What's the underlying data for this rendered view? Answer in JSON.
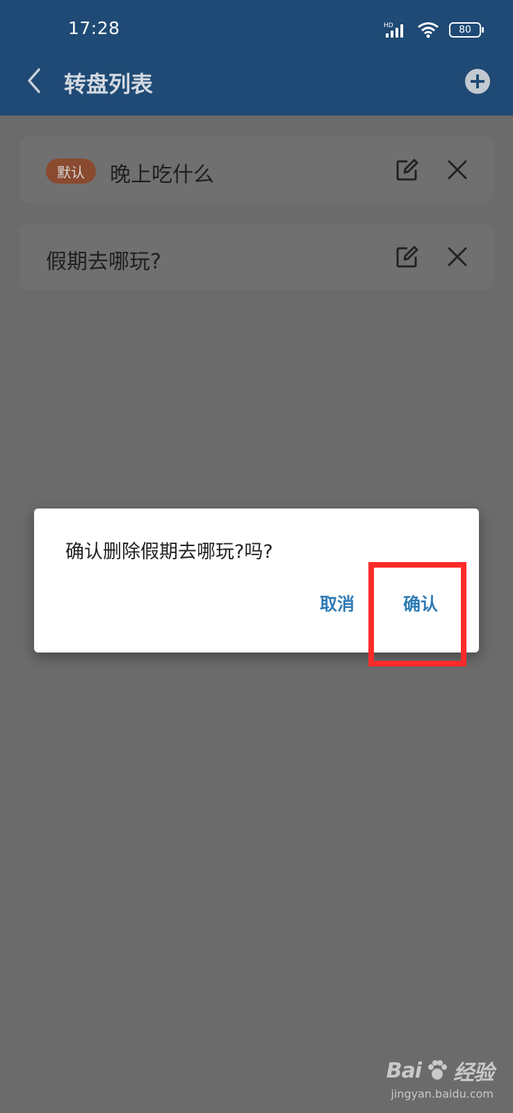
{
  "status_bar": {
    "time": "17:28",
    "network": "HD",
    "battery": "80"
  },
  "header": {
    "title": "转盘列表"
  },
  "list": {
    "items": [
      {
        "badge": "默认",
        "label": "晚上吃什么"
      },
      {
        "label": "假期去哪玩?"
      }
    ]
  },
  "dialog": {
    "message": "确认删除假期去哪玩?吗?",
    "cancel_label": "取消",
    "confirm_label": "确认"
  },
  "watermark": {
    "brand": "Bai",
    "brand_cn": "经验",
    "url": "jingyan.baidu.com"
  },
  "colors": {
    "header": "#1f4a75",
    "accent": "#2f7bb5",
    "badge": "#8a4a2f",
    "highlight": "#ff2b2b"
  }
}
